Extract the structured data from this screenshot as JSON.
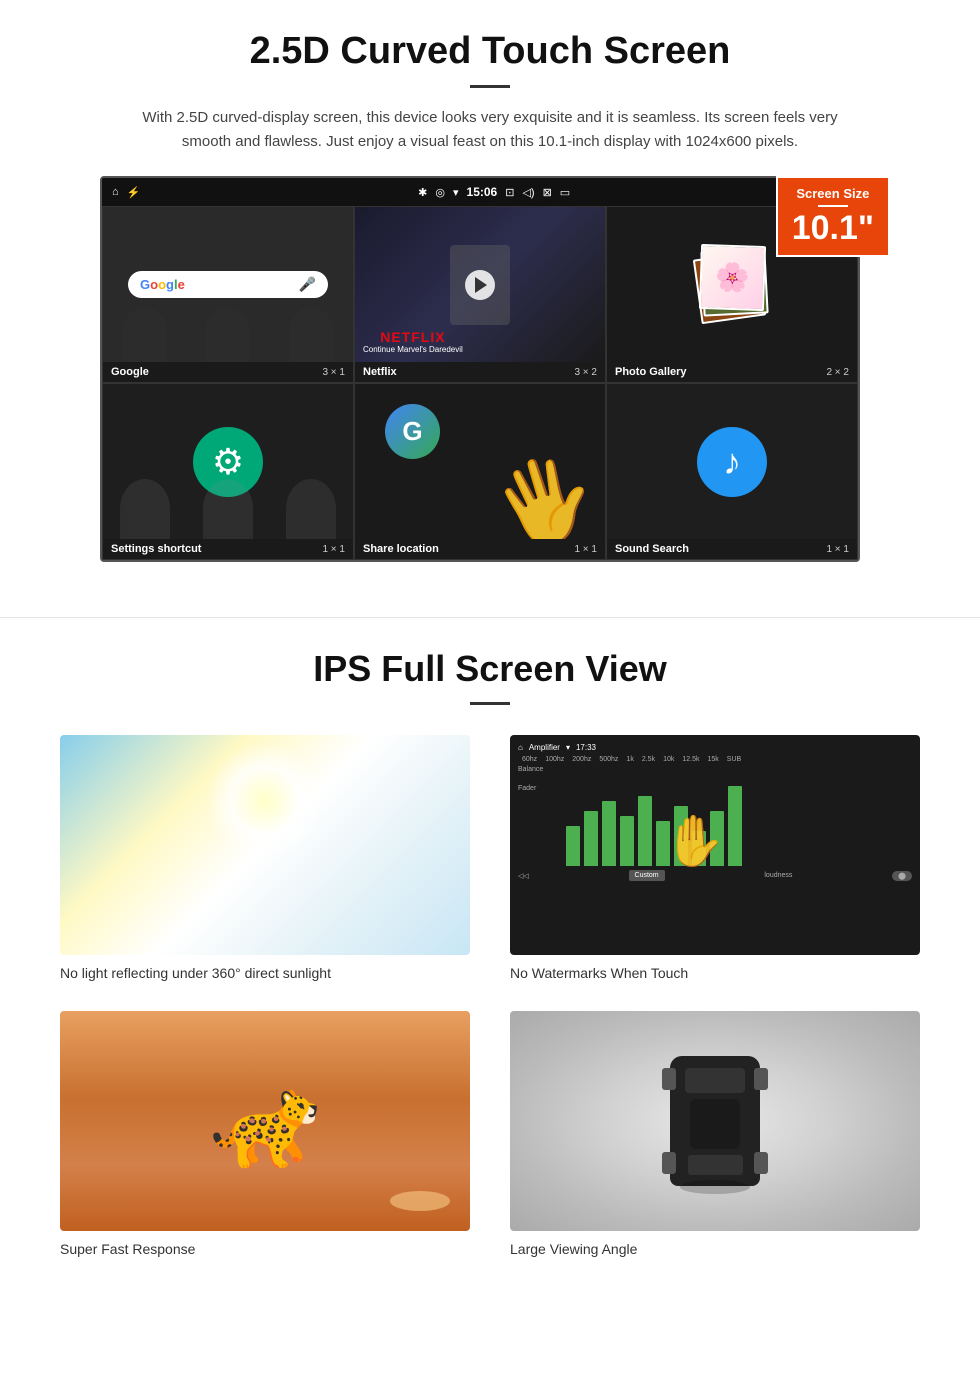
{
  "section1": {
    "title": "2.5D Curved Touch Screen",
    "description": "With 2.5D curved-display screen, this device looks very exquisite and it is seamless. Its screen feels very smooth and flawless. Just enjoy a visual feast on this 10.1-inch display with 1024x600 pixels.",
    "screen_size_badge": {
      "label": "Screen Size",
      "value": "10.1\""
    },
    "status_bar": {
      "time": "15:06"
    },
    "app_cells": [
      {
        "name": "Google",
        "dim": "3 × 1",
        "type": "google"
      },
      {
        "name": "Netflix",
        "dim": "3 × 2",
        "type": "netflix",
        "netflix_text": "NETFLIX",
        "netflix_sub": "Continue Marvel's Daredevil"
      },
      {
        "name": "Photo Gallery",
        "dim": "2 × 2",
        "type": "gallery"
      },
      {
        "name": "Settings shortcut",
        "dim": "1 × 1",
        "type": "settings"
      },
      {
        "name": "Share location",
        "dim": "1 × 1",
        "type": "share"
      },
      {
        "name": "Sound Search",
        "dim": "1 × 1",
        "type": "sound"
      }
    ]
  },
  "section2": {
    "title": "IPS Full Screen View",
    "features": [
      {
        "id": "sunlight",
        "caption": "No light reflecting under 360° direct sunlight"
      },
      {
        "id": "amplifier",
        "caption": "No Watermarks When Touch"
      },
      {
        "id": "cheetah",
        "caption": "Super Fast Response"
      },
      {
        "id": "car",
        "caption": "Large Viewing Angle"
      }
    ]
  }
}
